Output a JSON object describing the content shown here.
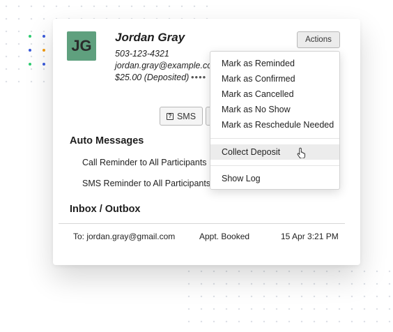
{
  "contact": {
    "initials": "JG",
    "name": "Jordan Gray",
    "phone": "503-123-4321",
    "email": "jordan.gray@example.com",
    "deposit": "$25.00 (Deposited)",
    "more": "••••"
  },
  "header": {
    "actions_label": "Actions"
  },
  "buttons": {
    "sms_label": "SMS",
    "sms_icon_glyph": "?"
  },
  "auto_messages": {
    "title": "Auto Messages",
    "items": [
      "Call Reminder to All Participants",
      "SMS Reminder to All Participants"
    ]
  },
  "inbox": {
    "title": "Inbox / Outbox",
    "rows": [
      {
        "to": "To: jordan.gray@gmail.com",
        "type": "Appt. Booked",
        "time": "15 Apr 3:21 PM"
      }
    ]
  },
  "actions_menu": {
    "group1": [
      "Mark as Reminded",
      "Mark as Confirmed",
      "Mark as Cancelled",
      "Mark as No Show",
      "Mark as Reschedule Needed"
    ],
    "collect_deposit": "Collect Deposit",
    "show_log": "Show Log"
  },
  "colors": {
    "avatar": "#5fa07e",
    "accent_dots": [
      "#2ecc71",
      "#3b5bdb",
      "#f39c12",
      "#1abc9c"
    ]
  }
}
